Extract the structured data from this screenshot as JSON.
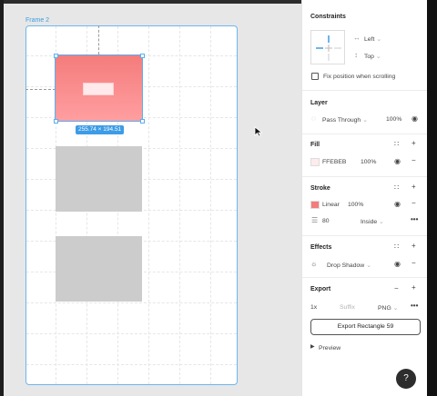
{
  "canvas": {
    "frame_label": "Frame 2",
    "dimension_badge": "255.74 × 194.51"
  },
  "panel": {
    "constraints": {
      "title": "Constraints",
      "horizontal": "Left",
      "vertical": "Top",
      "fix_position_label": "Fix position when scrolling"
    },
    "layer": {
      "title": "Layer",
      "blend_mode": "Pass Through",
      "opacity": "100%"
    },
    "fill": {
      "title": "Fill",
      "hex": "FFEBEB",
      "opacity": "100%",
      "color": "#FFEBEB"
    },
    "stroke": {
      "title": "Stroke",
      "type": "Linear",
      "opacity": "100%",
      "weight": "80",
      "position": "Inside",
      "color": "#F47C7C"
    },
    "effects": {
      "title": "Effects",
      "effect": "Drop Shadow"
    },
    "export": {
      "title": "Export",
      "scale": "1x",
      "suffix_placeholder": "Suffix",
      "format": "PNG",
      "button_label": "Export Rectangle 59",
      "preview_label": "Preview"
    }
  },
  "help": {
    "label": "?"
  },
  "colors": {
    "accent": "#3d9ce6",
    "selection": "#5aaef0"
  }
}
